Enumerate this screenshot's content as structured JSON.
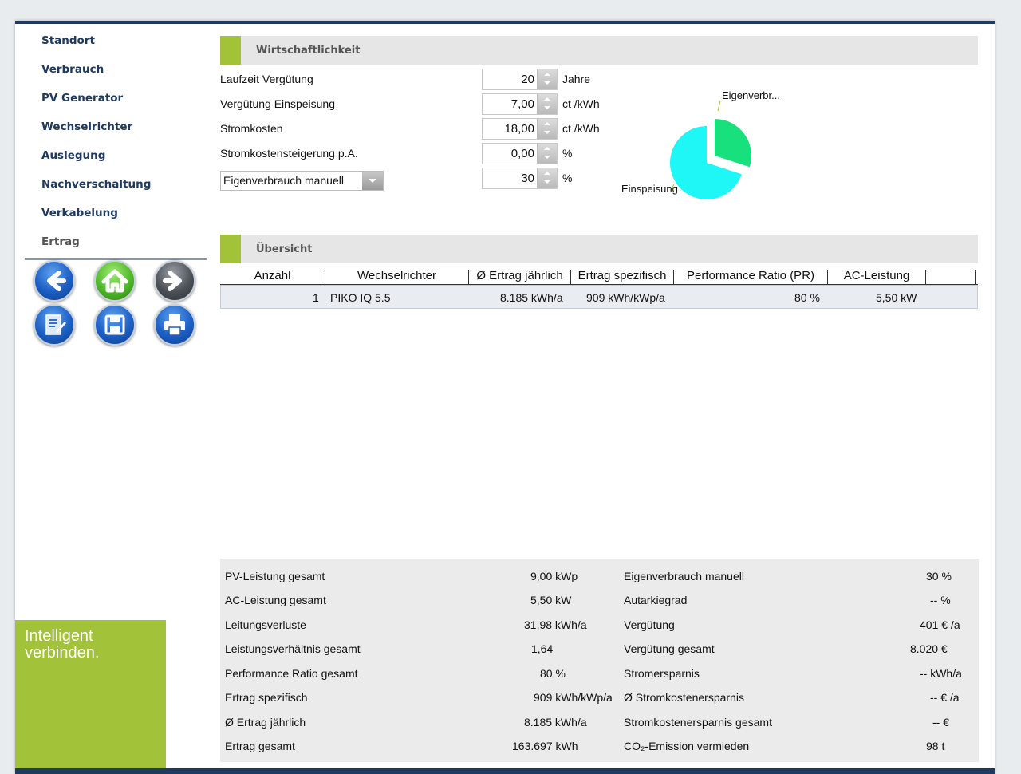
{
  "nav": {
    "items": [
      {
        "label": "Standort"
      },
      {
        "label": "Verbrauch"
      },
      {
        "label": "PV Generator"
      },
      {
        "label": "Wechselrichter"
      },
      {
        "label": "Auslegung"
      },
      {
        "label": "Nachverschaltung"
      },
      {
        "label": "Verkabelung"
      },
      {
        "label": "Ertrag"
      }
    ],
    "active": "Ertrag"
  },
  "toolbar": {
    "buttons": [
      "back-arrow-icon",
      "home-icon",
      "forward-arrow-icon",
      "edit-report-icon",
      "save-floppy-icon",
      "print-icon"
    ]
  },
  "brand": {
    "text": "Intelligent\nverbinden.",
    "color": "#a2c23a"
  },
  "wirtschaftlichkeit": {
    "title": "Wirtschaftlichkeit",
    "fields": [
      {
        "label": "Laufzeit Vergütung",
        "value": "20",
        "unit": "Jahre"
      },
      {
        "label": "Vergütung Einspeisung",
        "value": "7,00",
        "unit": "ct /kWh"
      },
      {
        "label": "Stromkosten",
        "value": "18,00",
        "unit": "ct /kWh"
      },
      {
        "label": "Stromkostensteigerung p.A.",
        "value": "0,00",
        "unit": "%"
      },
      {
        "select": "Eigenverbrauch manuell",
        "value": "30",
        "unit": "%"
      }
    ]
  },
  "pie": {
    "labels": {
      "eigenverbrauch": "Eigenverbr...",
      "einspeisung": "Einspeisung"
    },
    "eigenverbrauch_share": 0.3,
    "colors": {
      "eigenverbrauch": "#18e07c",
      "einspeisung": "#1ff6f6"
    }
  },
  "uebersicht": {
    "title": "Übersicht",
    "columns": [
      "Anzahl",
      "Wechselrichter",
      "Ø Ertrag jährlich",
      "Ertrag spezifisch",
      "Performance Ratio (PR)",
      "AC-Leistung"
    ],
    "rows": [
      {
        "anzahl": "1",
        "wechselrichter": "PIKO IQ 5.5",
        "ertrag": "8.185 kWh/a",
        "spezifisch": "909 kWh/kWp/a",
        "pr": "80 %",
        "ac": "5,50 kW"
      }
    ]
  },
  "summary": {
    "left": [
      {
        "label": "PV-Leistung gesamt",
        "value": "9,00 kWp"
      },
      {
        "label": "AC-Leistung gesamt",
        "value": "5,50 kW"
      },
      {
        "label": "Leitungsverluste",
        "value": "31,98 kWh/a"
      },
      {
        "label": "Leistungsverhältnis gesamt",
        "value": "1,64"
      },
      {
        "label": "Performance Ratio gesamt",
        "value": "80 %"
      },
      {
        "label": "Ertrag spezifisch",
        "value": "909 kWh/kWp/a"
      },
      {
        "label": "Ø Ertrag jährlich",
        "value": "8.185 kWh/a"
      },
      {
        "label": "Ertrag gesamt",
        "value": "163.697 kWh"
      }
    ],
    "right": [
      {
        "label": "Eigenverbrauch manuell",
        "value": "30 %"
      },
      {
        "label": "Autarkiegrad",
        "value": "-- %"
      },
      {
        "label": "Vergütung",
        "value": "401 € /a"
      },
      {
        "label": "Vergütung gesamt",
        "value": "8.020 €"
      },
      {
        "label": "Stromersparnis",
        "value": "-- kWh/a"
      },
      {
        "label": "Ø Stromkostenersparnis",
        "value": "-- € /a"
      },
      {
        "label": "Stromkostenersparnis gesamt",
        "value": "-- €"
      },
      {
        "label": "CO₂-Emission vermieden",
        "value": "98 t"
      }
    ]
  }
}
